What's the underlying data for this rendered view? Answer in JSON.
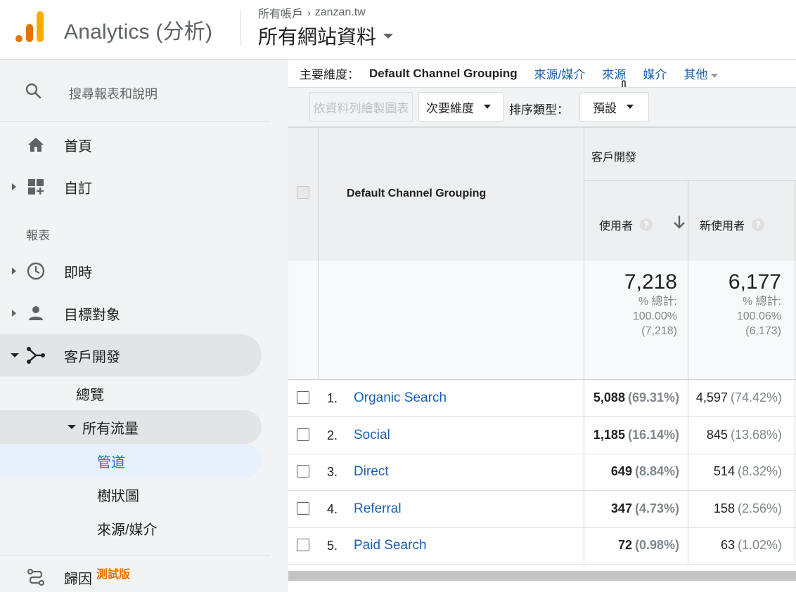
{
  "header": {
    "app_title": "Analytics (分析)",
    "breadcrumb": "所有帳戶",
    "account": "zanzan.tw",
    "view_name": "所有網站資料"
  },
  "sidebar": {
    "search_placeholder": "搜尋報表和說明",
    "items": [
      {
        "label": "首頁",
        "icon": "home-icon"
      },
      {
        "label": "自訂",
        "icon": "dashboard-add-icon"
      },
      {
        "label": "即時",
        "icon": "clock-icon"
      },
      {
        "label": "目標對象",
        "icon": "person-icon"
      },
      {
        "label": "客戶開發",
        "icon": "acquisition-icon"
      },
      {
        "label": "歸因",
        "icon": "attribution-icon",
        "badge": "測試版"
      }
    ],
    "section_label": "報表",
    "sub_items": [
      "總覽",
      "所有流量",
      "管道",
      "樹狀圖",
      "來源/媒介"
    ]
  },
  "dimension_bar": {
    "label": "主要維度：",
    "current": "Default Channel Grouping",
    "links": [
      "來源/媒介",
      "來源",
      "媒介",
      "其他"
    ]
  },
  "toolbar": {
    "plot_rows": "依資料列繪製圖表",
    "secondary_dimension": "次要維度",
    "sort_label": "排序類型：",
    "sort_value": "預設"
  },
  "table": {
    "dimension_header": "Default Channel Grouping",
    "group_header": "客戶開發",
    "metrics": [
      "使用者",
      "新使用者"
    ],
    "help": "?",
    "totals": [
      {
        "value": "7,218",
        "label": "% 總計:",
        "pct": "100.00%",
        "base": "(7,218)"
      },
      {
        "value": "6,177",
        "label": "% 總計:",
        "pct": "100.06%",
        "base": "(6,173)"
      }
    ],
    "rows": [
      {
        "idx": "1.",
        "name": "Organic Search",
        "users": "5,088",
        "users_pct": "(69.31%)",
        "new_users": "4,597",
        "new_pct": "(74.42%)"
      },
      {
        "idx": "2.",
        "name": "Social",
        "users": "1,185",
        "users_pct": "(16.14%)",
        "new_users": "845",
        "new_pct": "(13.68%)"
      },
      {
        "idx": "3.",
        "name": "Direct",
        "users": "649",
        "users_pct": "(8.84%)",
        "new_users": "514",
        "new_pct": "(8.32%)"
      },
      {
        "idx": "4.",
        "name": "Referral",
        "users": "347",
        "users_pct": "(4.73%)",
        "new_users": "158",
        "new_pct": "(2.56%)"
      },
      {
        "idx": "5.",
        "name": "Paid Search",
        "users": "72",
        "users_pct": "(0.98%)",
        "new_users": "63",
        "new_pct": "(1.02%)"
      }
    ]
  },
  "colors": {
    "accent_orange": "#e37400",
    "logo_yellow": "#f9ab00",
    "link_blue": "#1a5fb4",
    "selected_blue": "#1a73e8"
  }
}
